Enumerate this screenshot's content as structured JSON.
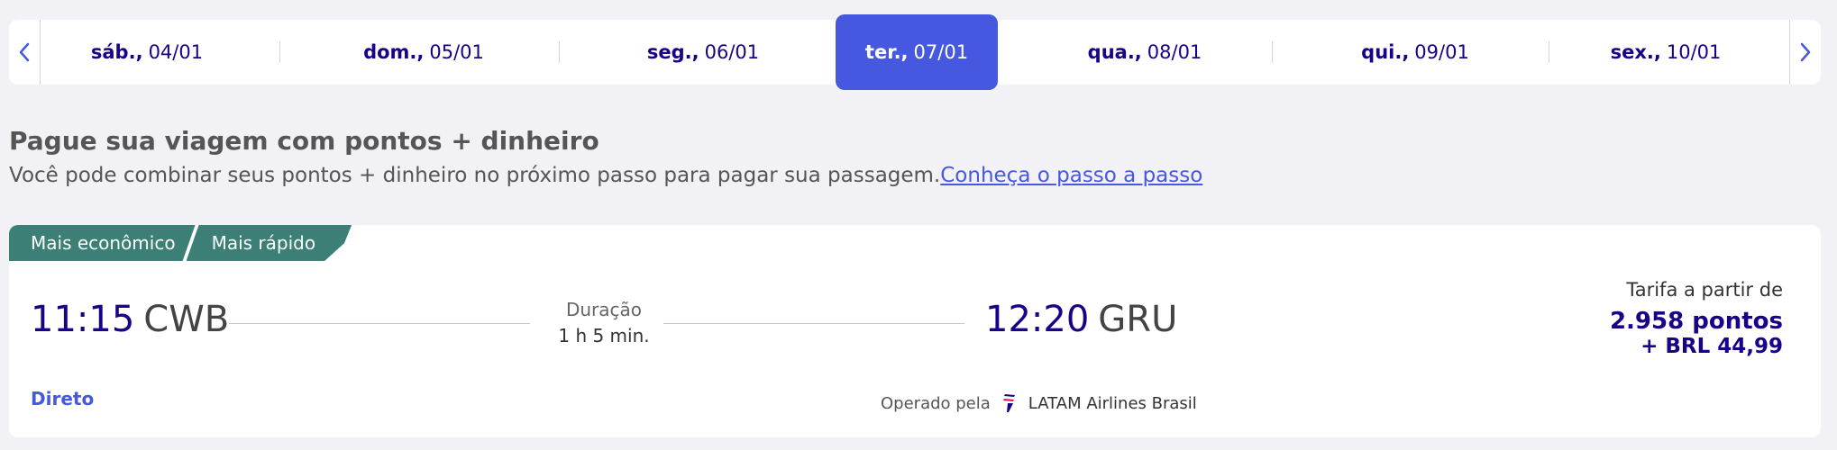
{
  "date_selector": {
    "dates": [
      {
        "day": "sáb.,",
        "date": "04/01"
      },
      {
        "day": "dom.,",
        "date": "05/01"
      },
      {
        "day": "seg.,",
        "date": "06/01"
      },
      {
        "day": "ter.,",
        "date": "07/01"
      },
      {
        "day": "qua.,",
        "date": "08/01"
      },
      {
        "day": "qui.,",
        "date": "09/01"
      },
      {
        "day": "sex.,",
        "date": "10/01"
      }
    ],
    "selected_index": 3,
    "selected_color": "#4658df"
  },
  "promo": {
    "title": "Pague sua viagem com pontos + dinheiro",
    "text": "Você pode combinar seus pontos + dinheiro no próximo passo para pagar sua passagem.",
    "link": "Conheça o passo a passo"
  },
  "flight": {
    "tags": [
      "Mais econômico",
      "Mais rápido"
    ],
    "departure": {
      "time": "11:15",
      "airport": "CWB"
    },
    "arrival": {
      "time": "12:20",
      "airport": "GRU"
    },
    "duration_label": "Duração",
    "duration": "1 h 5 min.",
    "fare_label": "Tarifa a partir de",
    "points": "2.958 pontos",
    "cash": "+ BRL 44,99",
    "stops": "Direto",
    "operated_by_label": "Operado pela",
    "airline": "LATAM Airlines Brasil",
    "icons": {
      "prev": "chevron-left-icon",
      "next": "chevron-right-icon",
      "airline_logo": "latam-logo-icon"
    }
  },
  "colors": {
    "primary": "#4658df",
    "navy": "#1b0088",
    "tag": "#3b7f77",
    "background": "#f1f1f6"
  }
}
